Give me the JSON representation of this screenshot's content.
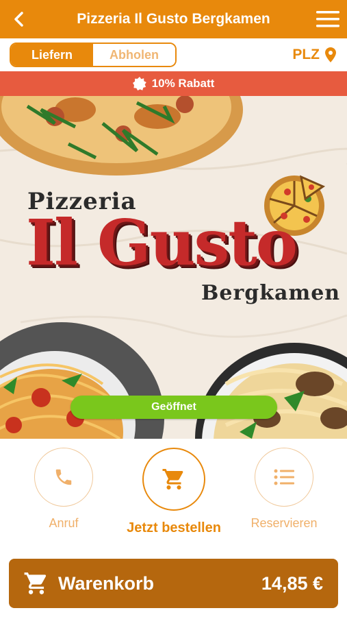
{
  "header": {
    "title": "Pizzeria Il Gusto Bergkamen"
  },
  "mode": {
    "deliver_label": "Liefern",
    "pickup_label": "Abholen",
    "selected": "Liefern",
    "plz_label": "PLZ"
  },
  "discount": {
    "label": "10% Rabatt"
  },
  "hero": {
    "logo_top": "Pizzeria",
    "logo_main": "Il Gusto",
    "logo_bottom": "Bergkamen",
    "status_label": "Geöffnet"
  },
  "actions": {
    "call_label": "Anruf",
    "order_label": "Jetzt bestellen",
    "reserve_label": "Reservieren"
  },
  "cart": {
    "label": "Warenkorb",
    "total": "14,85 €"
  },
  "colors": {
    "brand_orange": "#e8890c",
    "discount_red": "#e75b3f",
    "open_green": "#7ac71c",
    "cart_brown": "#b5670e",
    "logo_red": "#c52a2a"
  },
  "icons": {
    "back": "chevron-left-icon",
    "menu": "hamburger-menu-icon",
    "location": "map-pin-icon",
    "discount": "badge-icon",
    "call": "phone-icon",
    "order": "cart-icon",
    "reserve": "list-icon",
    "cart": "cart-icon"
  }
}
